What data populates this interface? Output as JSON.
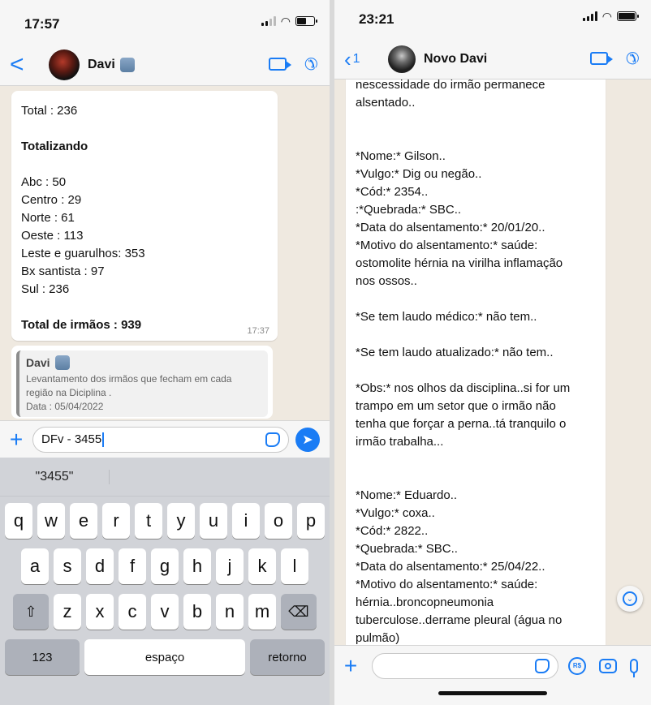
{
  "left": {
    "status_time": "17:57",
    "header": {
      "back": "<",
      "name": "Davi"
    },
    "message": {
      "lines": [
        "Total : 236",
        "",
        "Totalizando",
        "",
        "Abc : 50",
        "Centro : 29",
        "Norte : 61",
        "Oeste : 113",
        "Leste e guarulhos: 353",
        "Bx santista : 97",
        "Sul : 236",
        "",
        "Total de irmãos : 939"
      ],
      "time": "17:37"
    },
    "quote": {
      "name": "Davi",
      "text_line1": "Levantamento dos irmãos que fecham em cada",
      "text_line2": "região na Diciplina .",
      "text_line3": "Data : 05/04/2022"
    },
    "input_value": "DFv - 3455",
    "suggestions": [
      "\"3455\"",
      "",
      ""
    ],
    "keyboard": {
      "row1": [
        "q",
        "w",
        "e",
        "r",
        "t",
        "y",
        "u",
        "i",
        "o",
        "p"
      ],
      "row2": [
        "a",
        "s",
        "d",
        "f",
        "g",
        "h",
        "j",
        "k",
        "l"
      ],
      "row3": [
        "z",
        "x",
        "c",
        "v",
        "b",
        "n",
        "m"
      ],
      "numbers": "123",
      "space": "espaço",
      "return": "retorno"
    }
  },
  "right": {
    "status_time": "23:21",
    "header": {
      "back_count": "1",
      "name": "Novo Davi"
    },
    "message_lines": [
      "nescessidade do irmão permanece",
      "alsentado..",
      "",
      "",
      "*Nome:* Gilson..",
      "*Vulgo:* Dig ou negão..",
      "*Cód:* 2354..",
      ":*Quebrada:* SBC..",
      "*Data do alsentamento:* 20/01/20..",
      "*Motivo do alsentamento:* saúde:",
      "ostomolite hérnia na virilha inflamação",
      "nos ossos..",
      "",
      "*Se tem laudo médico:* não tem..",
      "",
      "*Se tem laudo atualizado:* não tem..",
      "",
      "*Obs:* nos olhos da disciplina..si for um",
      "trampo em um setor que o irmão não",
      "tenha que forçar a perna..tá tranquilo o",
      "irmão trabalha...",
      "",
      "",
      "*Nome:* Eduardo..",
      "*Vulgo:* coxa..",
      "*Cód:* 2822..",
      "*Quebrada:* SBC..",
      "*Data do alsentamento:* 25/04/22..",
      "*Motivo do alsentamento:* saúde:",
      "hérnia..broncopneumonia",
      "tuberculose..derrame pleural (água no",
      "pulmão)"
    ],
    "rs_label": "R$"
  }
}
